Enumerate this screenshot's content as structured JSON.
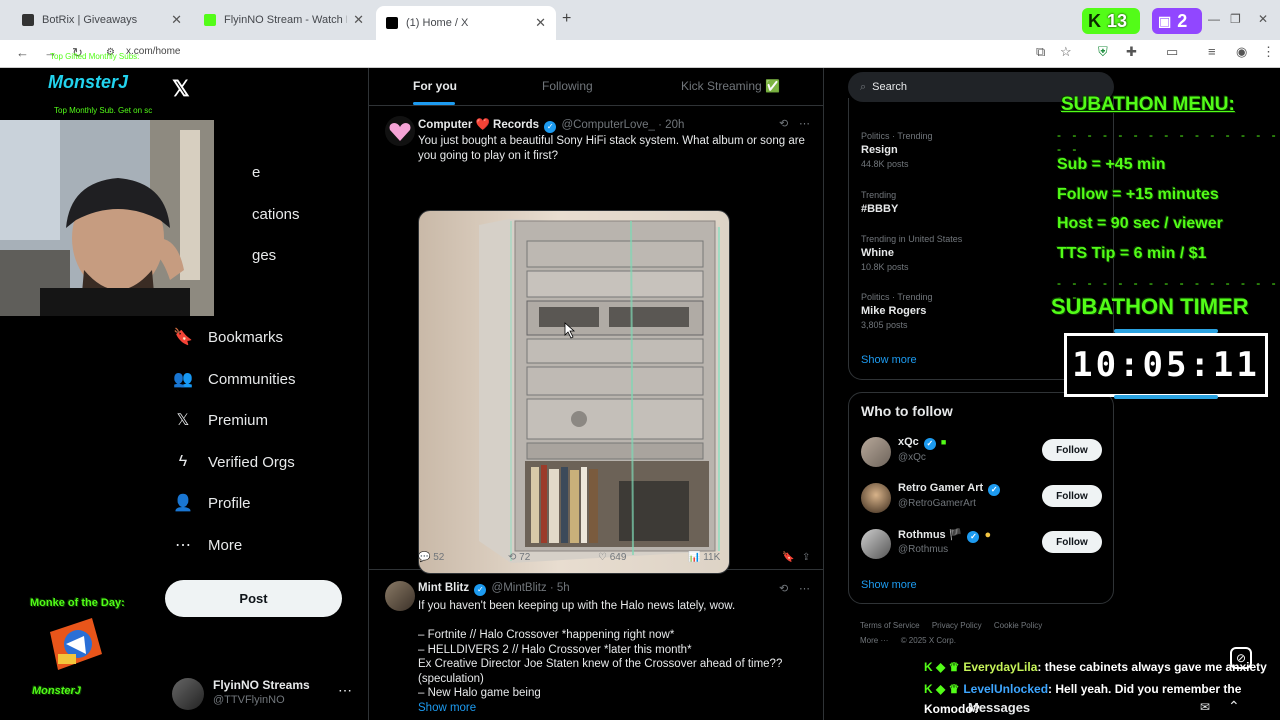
{
  "browser": {
    "tabs": [
      {
        "title": "BotRix | Giveaways",
        "close": "✕"
      },
      {
        "title": "FlyinNO Stream - Watch Live on",
        "close": "✕"
      },
      {
        "title": "(1) Home / X",
        "close": "✕"
      }
    ],
    "new_tab": "+",
    "url": "x.com/home",
    "kick_count": "13",
    "twitch_count": "2"
  },
  "left_nav": {
    "logo": "𝕏",
    "items": [
      {
        "label": "Bookmarks",
        "icon": "bookmark-icon",
        "glyph": "🔖"
      },
      {
        "label": "Communities",
        "icon": "communities-icon",
        "glyph": "👥"
      },
      {
        "label": "Premium",
        "icon": "x-premium-icon",
        "glyph": "𝕏"
      },
      {
        "label": "Verified Orgs",
        "icon": "lightning-icon",
        "glyph": "ϟ"
      },
      {
        "label": "Profile",
        "icon": "person-icon",
        "glyph": "👤"
      },
      {
        "label": "More",
        "icon": "more-circle-icon",
        "glyph": "⋯"
      }
    ],
    "partial_items": [
      "e",
      "cations",
      "ges"
    ],
    "post_label": "Post",
    "account": {
      "name": "FlyinNO Streams",
      "handle": "@TTVFlyinNO",
      "more": "⋯"
    }
  },
  "timeline": {
    "tabs": [
      "For you",
      "Following",
      "Kick Streaming ✅"
    ],
    "tweets": [
      {
        "name": "Computer ❤️ Records",
        "handle": "@ComputerLove_",
        "time": "20h",
        "text_lines": [
          "You just bought a beautiful Sony HiFi stack system. What album or song are",
          "you going to play on it first?"
        ],
        "replies": "52",
        "reposts": "72",
        "likes": "649",
        "views": "11K"
      },
      {
        "name": "Mint Blitz",
        "handle": "@MintBlitz",
        "time": "5h",
        "text_lines": [
          "If you haven't been keeping up with the Halo news lately, wow.",
          "",
          "– Fortnite // Halo Crossover *happening right now*",
          "– HELLDIVERS 2 // Halo Crossover *later this month*",
          "Ex Creative Director Joe Staten knew of the Crossover ahead of time??",
          "(speculation)",
          "– New Halo game being"
        ],
        "show_more": "Show more"
      }
    ]
  },
  "right_col": {
    "search_placeholder": "Search",
    "trends": [
      {
        "context": "Politics · Trending",
        "topic": "Resign",
        "count": "44.8K posts"
      },
      {
        "context": "Trending",
        "topic": "#BBBY",
        "count": ""
      },
      {
        "context": "Trending in United States",
        "topic": "Whine",
        "count": "10.8K posts"
      },
      {
        "context": "Politics · Trending",
        "topic": "Mike Rogers",
        "count": "3,805 posts"
      }
    ],
    "trends_show_more": "Show more",
    "who_to_follow": {
      "title": "Who to follow",
      "users": [
        {
          "name": "xQc",
          "handle": "@xQc",
          "follow": "Follow"
        },
        {
          "name": "Retro Gamer Art",
          "handle": "@RetroGamerArt",
          "follow": "Follow"
        },
        {
          "name": "Rothmus 🏴",
          "handle": "@Rothmus",
          "follow": "Follow"
        }
      ],
      "show_more": "Show more"
    },
    "footer": [
      "Terms of Service",
      "Privacy Policy",
      "Cookie Policy",
      "More ···",
      "© 2025 X Corp."
    ]
  },
  "overlay": {
    "monster_top": "MonsterJ",
    "top_sub_small": "Top Gifted Monthly Subs:",
    "top_sub_line": "Top Monthly Sub. Get on sc",
    "monke_title": "Monke of the Day:",
    "monke_name": "MonsterJ",
    "subathon_menu_title": "SUBATHON MENU:",
    "dashes": "- - - - - - - - - - - - - - - - -",
    "sub_lines": [
      "Sub = +45 min",
      "Follow = +15 minutes",
      "Host = 90 sec / viewer",
      "TTS Tip = 6 min / $1"
    ],
    "timer_title": "SUBATHON TIMER",
    "timer_value": "10:05:11"
  },
  "chat": {
    "messages": [
      {
        "user": "EverydayLila",
        "text": ": these cabinets always gave me anxiety"
      },
      {
        "user": "LevelUnlocked",
        "text": ": Hell yeah. Did you remember the"
      }
    ],
    "partial": "Komodo?",
    "messages_label": "Messages"
  },
  "colors": {
    "x_blue": "#1d9bf0",
    "kick_green": "#53fc18",
    "twitch_purple": "#9147ff",
    "overlay_cyan": "#22d3ee"
  }
}
